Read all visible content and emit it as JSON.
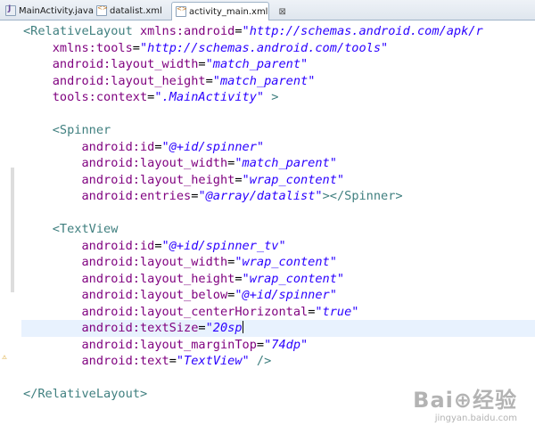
{
  "tabs": [
    {
      "label": "MainActivity.java",
      "icon": "java-file-icon",
      "active": false
    },
    {
      "label": "datalist.xml",
      "icon": "xml-file-icon",
      "active": false
    },
    {
      "label": "activity_main.xml",
      "icon": "xml-file-icon",
      "active": true,
      "close": "⊠"
    }
  ],
  "colors": {
    "tag": "#3f7f7f",
    "attribute": "#7f007f",
    "value": "#2a00ff",
    "current_line": "#e8f2fe"
  },
  "code_lines": [
    [
      [
        "tag",
        "<RelativeLayout "
      ],
      [
        "attr",
        "xmlns:android"
      ],
      [
        "eq",
        "="
      ],
      [
        "val",
        "\"http://schemas.android.com/apk/r"
      ]
    ],
    [
      [
        "attr",
        "    xmlns:tools"
      ],
      [
        "eq",
        "="
      ],
      [
        "val",
        "\"http://schemas.android.com/tools\""
      ]
    ],
    [
      [
        "attr",
        "    android:layout_width"
      ],
      [
        "eq",
        "="
      ],
      [
        "val",
        "\"match_parent\""
      ]
    ],
    [
      [
        "attr",
        "    android:layout_height"
      ],
      [
        "eq",
        "="
      ],
      [
        "val",
        "\"match_parent\""
      ]
    ],
    [
      [
        "attr",
        "    tools:context"
      ],
      [
        "eq",
        "="
      ],
      [
        "val",
        "\".MainActivity\""
      ],
      [
        "punct",
        " >"
      ]
    ],
    [],
    [
      [
        "tag",
        "    <Spinner"
      ]
    ],
    [
      [
        "attr",
        "        android:id"
      ],
      [
        "eq",
        "="
      ],
      [
        "val",
        "\"@+id/spinner\""
      ]
    ],
    [
      [
        "attr",
        "        android:layout_width"
      ],
      [
        "eq",
        "="
      ],
      [
        "val",
        "\"match_parent\""
      ]
    ],
    [
      [
        "attr",
        "        android:layout_height"
      ],
      [
        "eq",
        "="
      ],
      [
        "val",
        "\"wrap_content\""
      ]
    ],
    [
      [
        "attr",
        "        android:entries"
      ],
      [
        "eq",
        "="
      ],
      [
        "val",
        "\"@array/datalist\""
      ],
      [
        "tag",
        "></Spinner>"
      ]
    ],
    [],
    [
      [
        "tag",
        "    <TextView"
      ]
    ],
    [
      [
        "attr",
        "        android:id"
      ],
      [
        "eq",
        "="
      ],
      [
        "val",
        "\"@+id/spinner_tv\""
      ]
    ],
    [
      [
        "attr",
        "        android:layout_width"
      ],
      [
        "eq",
        "="
      ],
      [
        "val",
        "\"wrap_content\""
      ]
    ],
    [
      [
        "attr",
        "        android:layout_height"
      ],
      [
        "eq",
        "="
      ],
      [
        "val",
        "\"wrap_content\""
      ]
    ],
    [
      [
        "attr",
        "        android:layout_below"
      ],
      [
        "eq",
        "="
      ],
      [
        "val",
        "\"@+id/spinner\""
      ]
    ],
    [
      [
        "attr",
        "        android:layout_centerHorizontal"
      ],
      [
        "eq",
        "="
      ],
      [
        "val",
        "\"true\""
      ]
    ],
    [
      [
        "attr",
        "        android:textSize"
      ],
      [
        "eq",
        "="
      ],
      [
        "val",
        "\"20sp"
      ],
      [
        "caret",
        ""
      ]
    ],
    [
      [
        "attr",
        "        android:layout_marginTop"
      ],
      [
        "eq",
        "="
      ],
      [
        "val",
        "\"74dp\""
      ]
    ],
    [
      [
        "attr",
        "        android:text"
      ],
      [
        "eq",
        "="
      ],
      [
        "val",
        "\"TextView\""
      ],
      [
        "punct",
        " />"
      ]
    ],
    [],
    [
      [
        "tag",
        "</RelativeLayout>"
      ]
    ]
  ],
  "current_line_index": 18,
  "watermark": {
    "title": "Bai⊕经验",
    "subtitle": "jingyan.baidu.com"
  }
}
